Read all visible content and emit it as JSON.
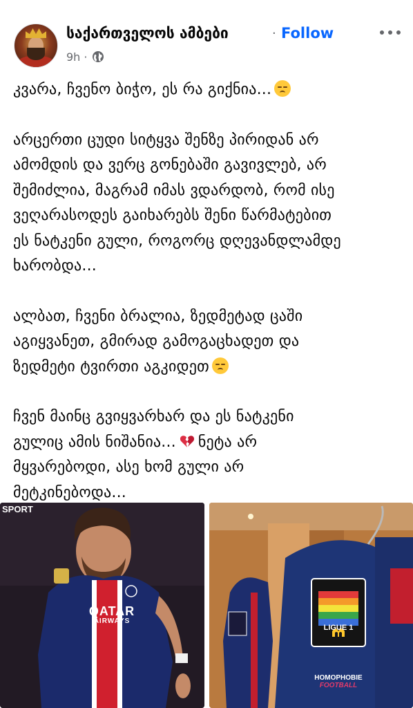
{
  "post": {
    "author": "საქართველოს ამბები",
    "separator": "·",
    "follow_label": "Follow",
    "time": "9h",
    "time_separator": "·",
    "paragraphs": [
      "კვარა, ჩვენო ბიჭო, ეს რა გიქნია...",
      "არცერთი ცუდი სიტყვა შენზე პირიდან არ\nამომდის და ვერც გონებაში გავივლებ, არ\nშემიძლია, მაგრამ იმას ვდარდობ, რომ ისე\nვეღარასოდეს გაიხარებს შენი წარმატებით\nეს ნატკენი გული, როგორც დღევანდლამდე\nხარობდა...",
      "ალბათ, ჩვენი ბრალია, ზედმეტად ცაში\nაგიყვანეთ, გმირად გამოგაცხადეთ და\nზედმეტი ტვირთი აგკიდეთ",
      "ჩვენ მაინც გვიყვარხარ და ეს ნატკენი\nგულიც ამის ნიშანია...",
      "ნეტა არ\nმყვარებოდი, ასე ხომ გული არ\nმეტკინებოდა..."
    ]
  },
  "photos": {
    "left_label": "SPORT",
    "jersey_sponsor_line1": "QATAR",
    "jersey_sponsor_line2": "AIRWAYS",
    "league_badge": "LIGUE 1",
    "sleeve_text_1": "HOMOPHOBIE",
    "sleeve_text_2": "FOOTBALL"
  },
  "icons": {
    "more": "more-horizontal-icon",
    "privacy": "globe-icon",
    "sad": "sad-face-emoji",
    "broken_heart": "broken-heart-emoji"
  },
  "colors": {
    "follow": "#0866ff",
    "muted": "#65676b",
    "text": "#050505"
  }
}
